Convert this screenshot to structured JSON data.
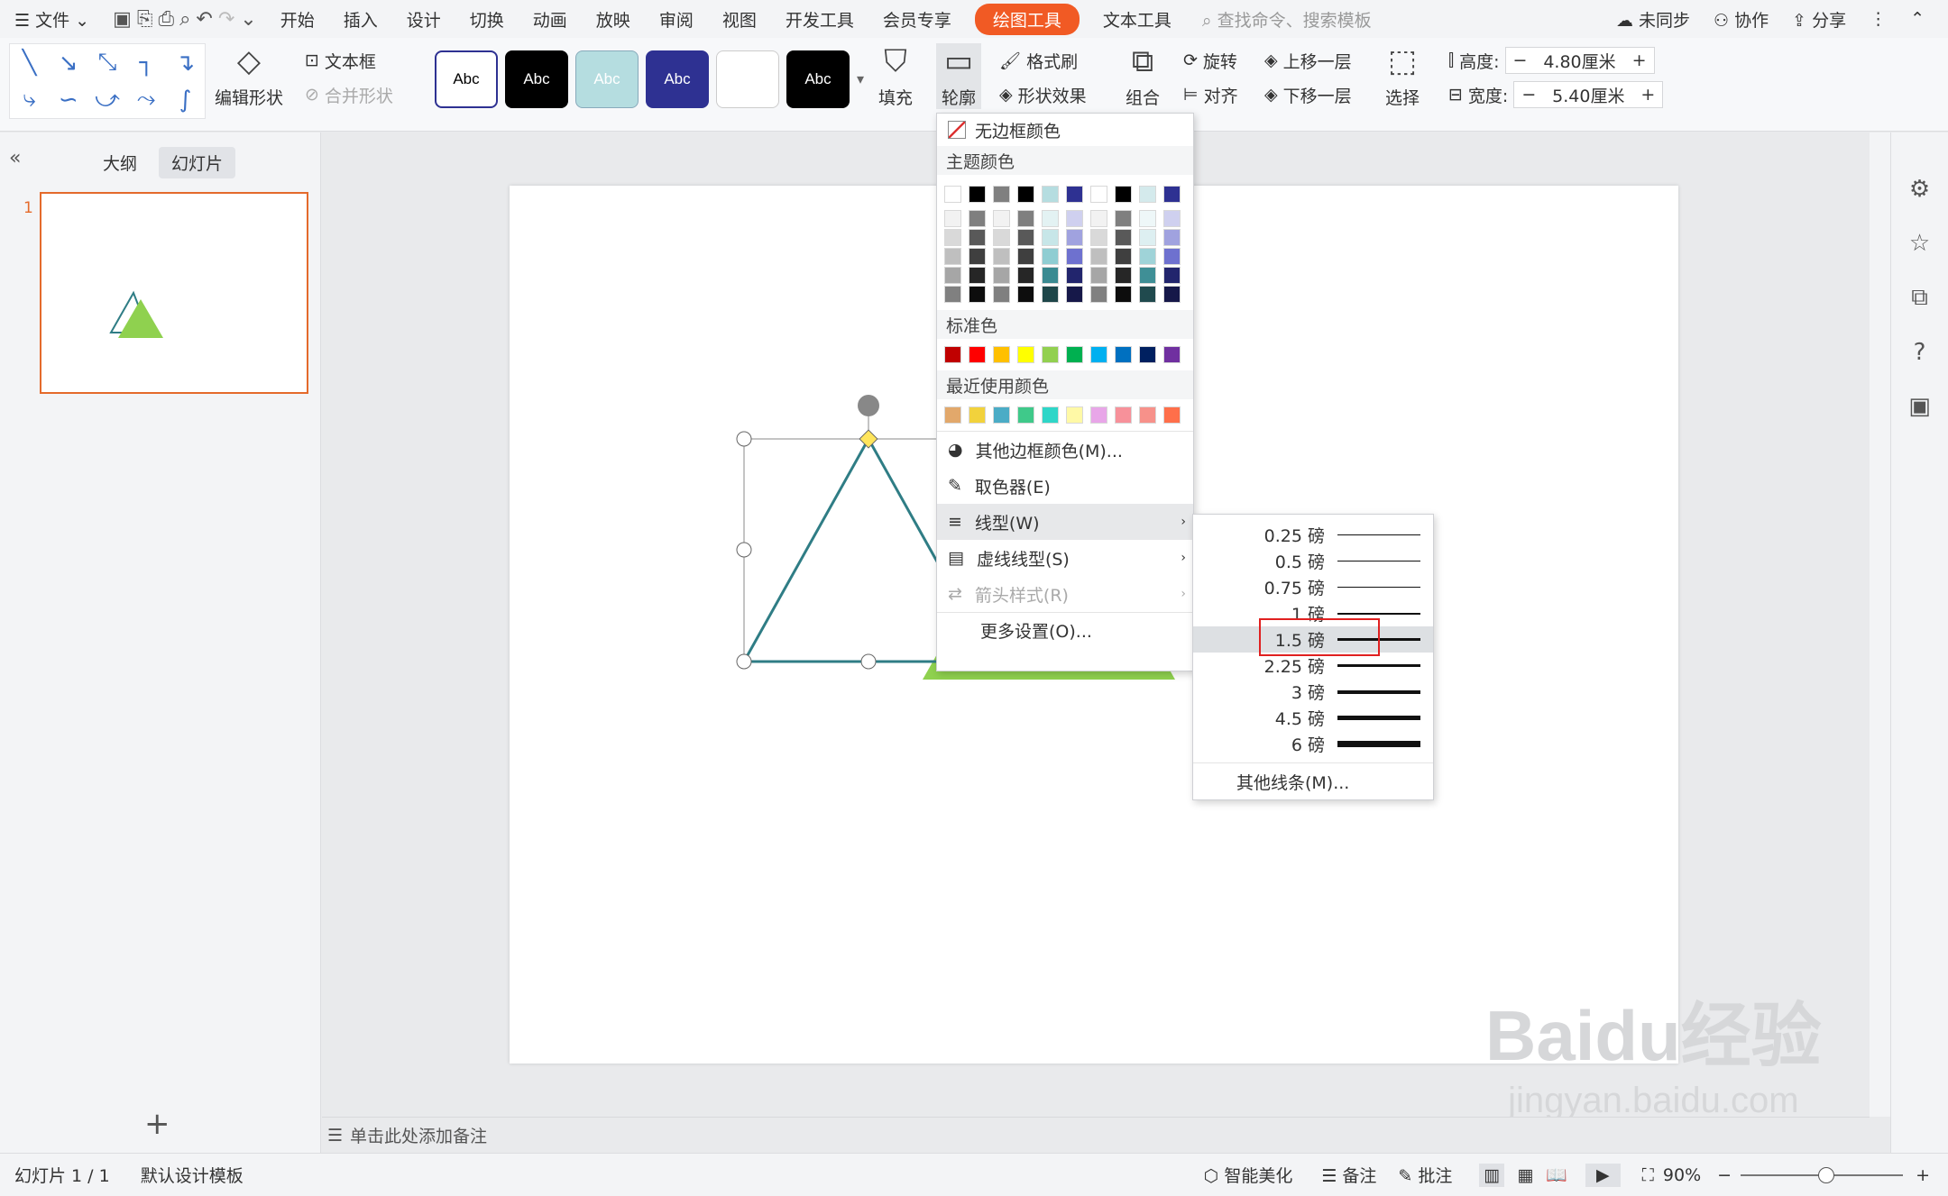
{
  "menubar": {
    "file": "文件",
    "tabs": [
      "开始",
      "插入",
      "设计",
      "切换",
      "动画",
      "放映",
      "审阅",
      "视图",
      "开发工具",
      "会员专享"
    ],
    "drawing_tools": "绘图工具",
    "text_tools": "文本工具",
    "search_placeholder": "查找命令、搜索模板",
    "unsynced": "未同步",
    "collab": "协作",
    "share": "分享"
  },
  "ribbon": {
    "edit_shape": "编辑形状",
    "textbox": "文本框",
    "merge_shape": "合并形状",
    "style_label": "Abc",
    "fill": "填充",
    "outline": "轮廓",
    "format_painter": "格式刷",
    "shape_effects": "形状效果",
    "group": "组合",
    "rotate": "旋转",
    "align": "对齐",
    "bring_forward": "上移一层",
    "send_backward": "下移一层",
    "select": "选择",
    "height_label": "高度:",
    "height_value": "4.80厘米",
    "width_label": "宽度:",
    "width_value": "5.40厘米"
  },
  "left_panel": {
    "tab_outline": "大纲",
    "tab_slides": "幻灯片",
    "slide_number": "1"
  },
  "notes": {
    "placeholder": "单击此处添加备注"
  },
  "outline_menu": {
    "no_border": "无边框颜色",
    "theme_colors": "主题颜色",
    "standard_colors": "标准色",
    "recent_colors": "最近使用颜色",
    "more_colors": "其他边框颜色(M)...",
    "eyedropper": "取色器(E)",
    "line_style": "线型(W)",
    "dash_style": "虚线线型(S)",
    "arrow_style": "箭头样式(R)",
    "more_settings": "更多设置(O)...",
    "theme_top": [
      "#ffffff",
      "#000000",
      "#808080",
      "#000000",
      "#b5dde0",
      "#2e3192",
      "#ffffff",
      "#000000",
      "#d4eaec",
      "#2e3192"
    ],
    "theme_rows": [
      [
        "#f2f2f2",
        "#7f7f7f",
        "#f2f2f2",
        "#7f7f7f",
        "#e3f2f3",
        "#cfd0ef",
        "#f2f2f2",
        "#7f7f7f",
        "#eef7f8",
        "#cfd0ef"
      ],
      [
        "#d9d9d9",
        "#595959",
        "#d9d9d9",
        "#595959",
        "#c7e6e8",
        "#a0a2df",
        "#d9d9d9",
        "#595959",
        "#ddeff1",
        "#a0a2df"
      ],
      [
        "#bfbfbf",
        "#3f3f3f",
        "#bfbfbf",
        "#3f3f3f",
        "#8fcdd2",
        "#6e71cf",
        "#bfbfbf",
        "#3f3f3f",
        "#9fd3d8",
        "#6e71cf"
      ],
      [
        "#a6a6a6",
        "#262626",
        "#a6a6a6",
        "#262626",
        "#3a8a91",
        "#22256d",
        "#a6a6a6",
        "#262626",
        "#3f8f96",
        "#22256d"
      ],
      [
        "#808080",
        "#0d0d0d",
        "#808080",
        "#0d0d0d",
        "#1e4649",
        "#161849",
        "#808080",
        "#0d0d0d",
        "#204a4e",
        "#161849"
      ]
    ],
    "standard": [
      "#c00000",
      "#ff0000",
      "#ffc000",
      "#ffff00",
      "#92d050",
      "#00b050",
      "#00b0f0",
      "#0070c0",
      "#002060",
      "#7030a0"
    ],
    "recent": [
      "#e2a86b",
      "#f2d23c",
      "#4bacc6",
      "#3fc98a",
      "#2fd6c8",
      "#fff9a6",
      "#e8a6e8",
      "#f7919a",
      "#f7918a",
      "#ff6f4a"
    ]
  },
  "line_width_menu": {
    "items": [
      "0.25 磅",
      "0.5 磅",
      "0.75 磅",
      "1 磅",
      "1.5 磅",
      "2.25 磅",
      "3 磅",
      "4.5 磅",
      "6 磅"
    ],
    "selected": "1.5 磅",
    "more": "其他线条(M)..."
  },
  "status": {
    "slide_info": "幻灯片 1 / 1",
    "template": "默认设计模板",
    "beautify": "智能美化",
    "notes": "备注",
    "comments": "批注",
    "zoom": "90%"
  },
  "watermark": {
    "line1": "Baidu经验",
    "line2": "jingyan.baidu.com"
  }
}
